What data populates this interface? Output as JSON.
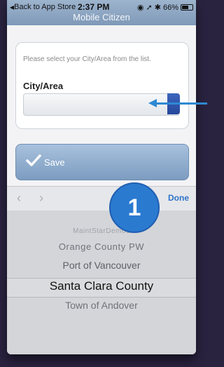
{
  "status_bar": {
    "back_label": "Back to App Store",
    "time": "2:37 PM",
    "battery": "66%",
    "battery_level": 0.66
  },
  "header": {
    "title": "Mobile Citizen"
  },
  "form": {
    "instruction": "Please select your City/Area from the list.",
    "field_label": "City/Area",
    "field_value": ""
  },
  "save_button": {
    "label": "Save"
  },
  "toolbar": {
    "done_label": "Done"
  },
  "picker": {
    "options": [
      "MaintStarDemo1",
      "Orange County PW",
      "Port of Vancouver",
      "Santa Clara County",
      "Town of Andover"
    ],
    "selected": "Santa Clara County"
  },
  "annotation": {
    "badge_number": "1"
  },
  "colors": {
    "accent_blue": "#2a7ad0",
    "header_blue": "#8aa5c2",
    "done_blue": "#2e74c9"
  }
}
